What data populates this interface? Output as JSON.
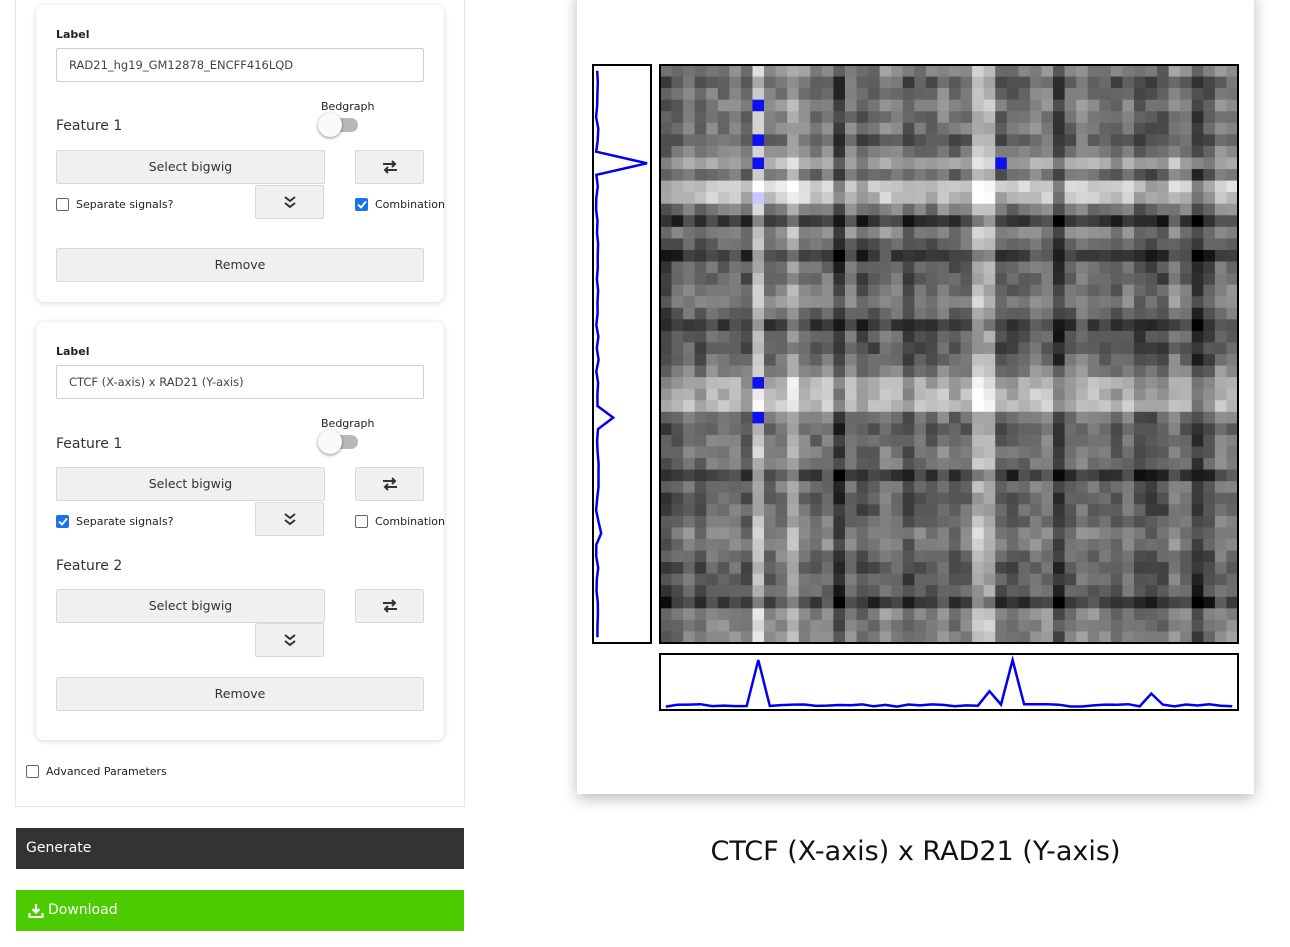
{
  "panel": {
    "cards": [
      {
        "label_caption": "Label",
        "label_value": "RAD21_hg19_GM12878_ENCFF416LQD",
        "features": [
          {
            "title": "Feature 1",
            "bedgraph_label": "Bedgraph",
            "select_label": "Select bigwig",
            "separate_label": "Separate signals?",
            "separate_checked": false,
            "combination_label": "Combination",
            "combination_checked": true
          }
        ],
        "remove_label": "Remove"
      },
      {
        "label_caption": "Label",
        "label_value": "CTCF (X-axis) x RAD21 (Y-axis)",
        "features": [
          {
            "title": "Feature 1",
            "bedgraph_label": "Bedgraph",
            "select_label": "Select bigwig",
            "separate_label": "Separate signals?",
            "separate_checked": true,
            "combination_label": "Combination",
            "combination_checked": false
          },
          {
            "title": "Feature 2",
            "select_label": "Select bigwig"
          }
        ],
        "remove_label": "Remove"
      }
    ],
    "advanced_label": "Advanced Parameters",
    "advanced_checked": false
  },
  "actions": {
    "generate_label": "Generate",
    "download_label": "Download",
    "download_color": "#4ccb00",
    "generate_color": "#333333"
  },
  "plot": {
    "title": "CTCF (X-axis) x RAD21 (Y-axis)",
    "chart_data": {
      "type": "heatmap",
      "grid_size": 50,
      "colormap": "grayscale with blue for maxima",
      "x_signal_color": "#0000ee",
      "y_signal_color": "#0000ee",
      "bright_columns": [
        8,
        11,
        27,
        28
      ],
      "bright_rows": [
        8,
        10,
        11,
        27,
        28,
        29
      ],
      "dark_columns": [
        15,
        34,
        46
      ],
      "dark_rows": [
        13,
        16,
        22,
        35,
        46
      ],
      "blue_cells": [
        [
          8,
          8
        ],
        [
          8,
          29
        ],
        [
          30,
          8
        ],
        [
          27,
          8
        ],
        [
          3,
          8
        ],
        [
          6,
          8
        ]
      ],
      "top_signal_peaks": [
        {
          "x": 8,
          "value": 1.0
        },
        {
          "x": 30,
          "value": 1.0
        },
        {
          "x": 28,
          "value": 0.35
        },
        {
          "x": 42,
          "value": 0.3
        }
      ],
      "side_signal_peaks": [
        {
          "y": 8,
          "value": 1.0
        },
        {
          "y": 30,
          "value": 0.35
        },
        {
          "y": 40,
          "value": 0.12
        }
      ]
    }
  }
}
